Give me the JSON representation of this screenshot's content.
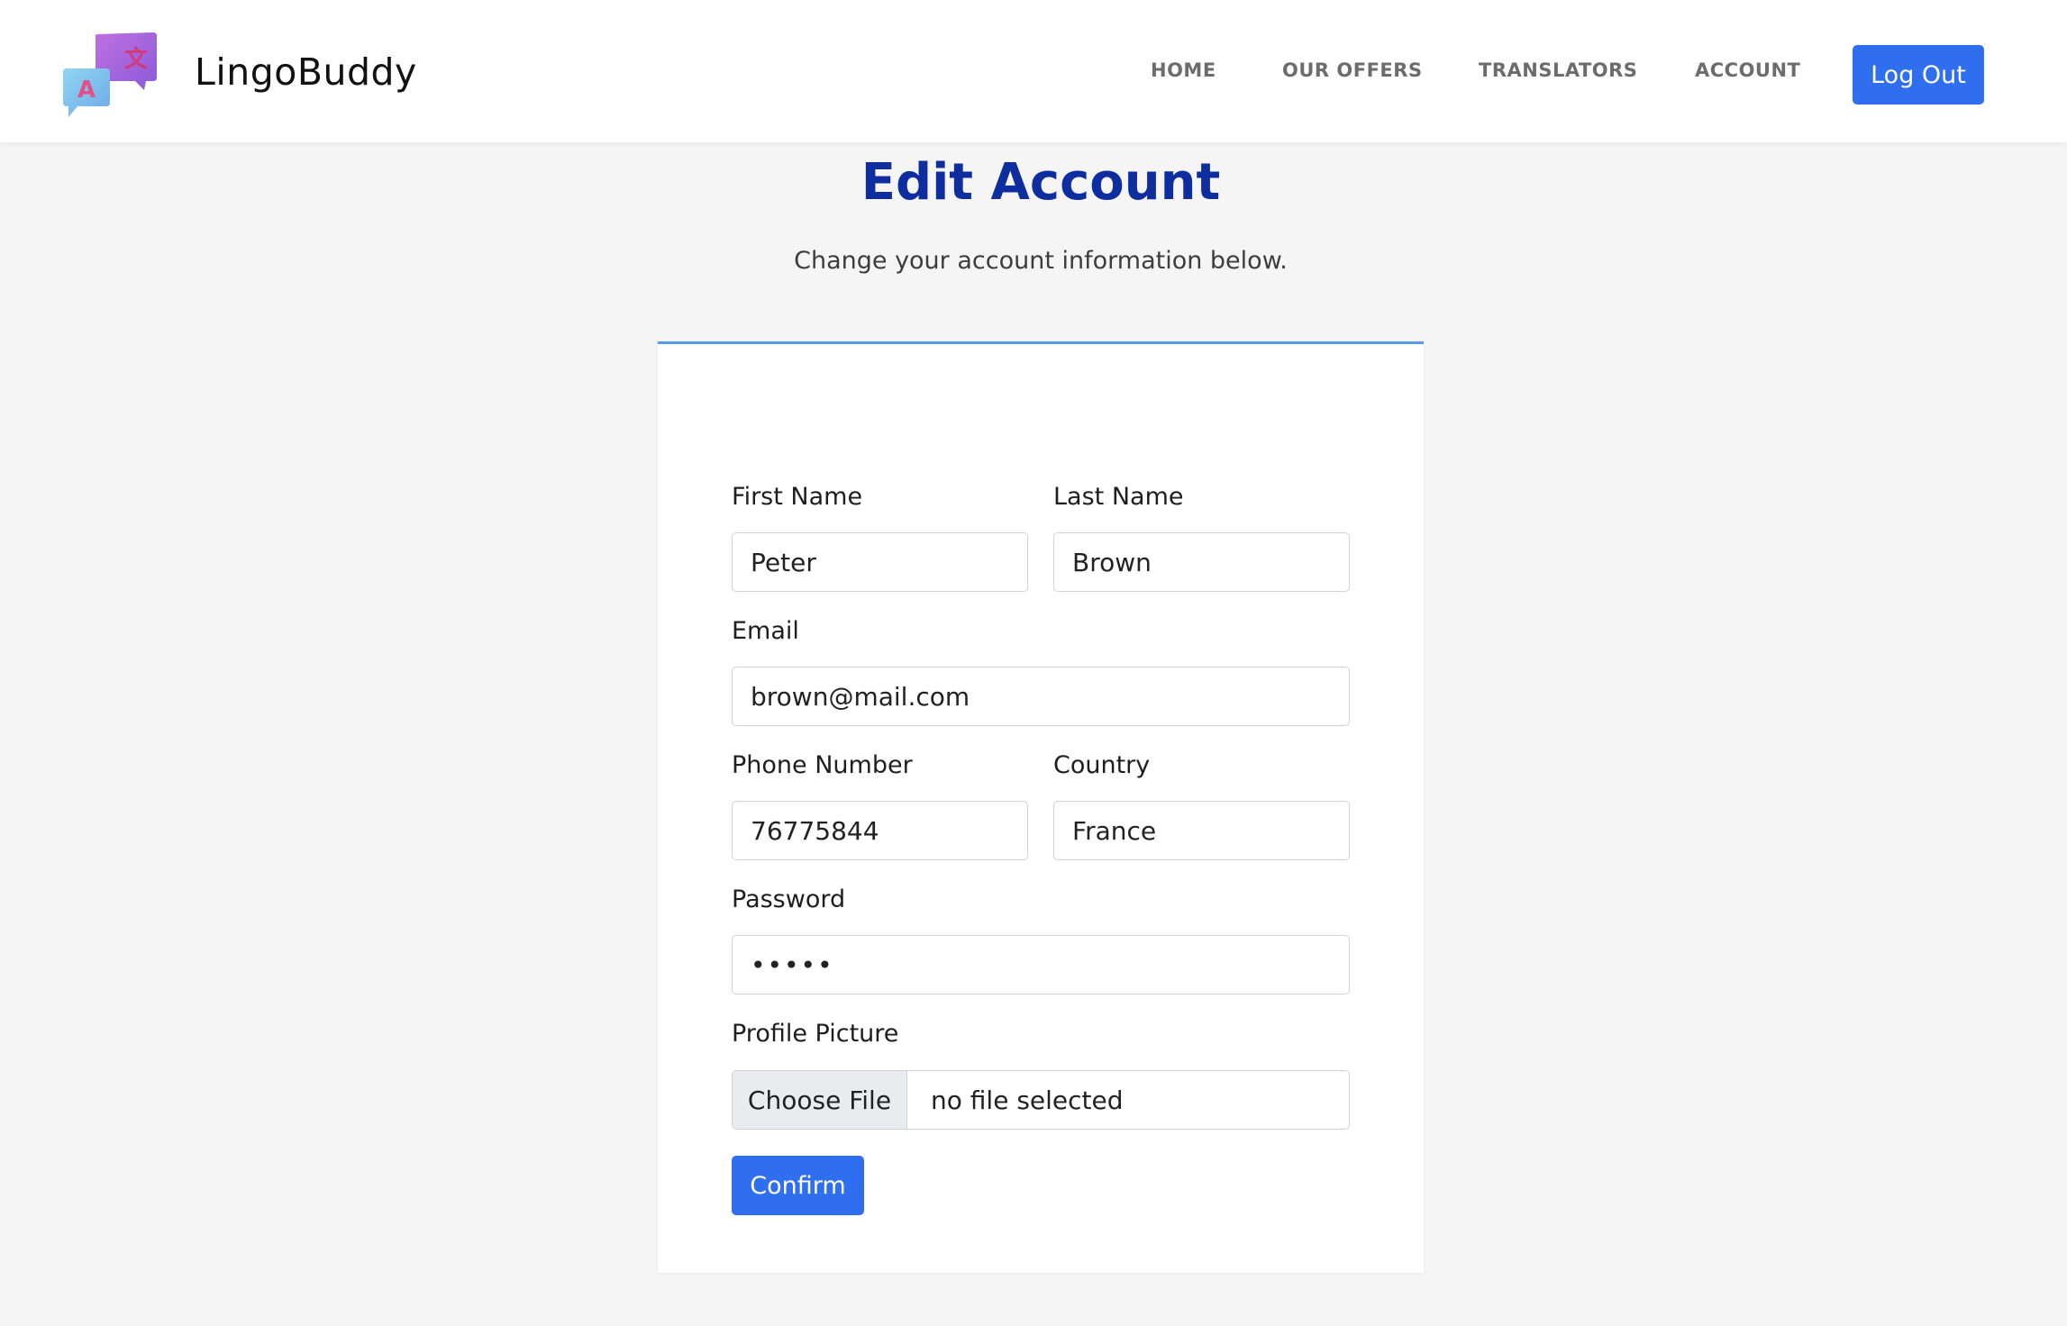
{
  "brand": {
    "name": "LingoBuddy",
    "logo_glyphs": [
      "A",
      "文"
    ]
  },
  "nav": {
    "links": [
      "HOME",
      "OUR OFFERS",
      "TRANSLATORS",
      "ACCOUNT"
    ],
    "logout_label": "Log Out"
  },
  "page": {
    "title": "Edit Account",
    "subtitle": "Change your account information below."
  },
  "form": {
    "first_name": {
      "label": "First Name",
      "value": "Peter"
    },
    "last_name": {
      "label": "Last Name",
      "value": "Brown"
    },
    "email": {
      "label": "Email",
      "value": "brown@mail.com"
    },
    "phone": {
      "label": "Phone Number",
      "value": "76775844"
    },
    "country": {
      "label": "Country",
      "value": "France"
    },
    "password": {
      "label": "Password",
      "value": "•••••"
    },
    "profile_picture": {
      "label": "Profile Picture",
      "button_label": "Choose File",
      "status": "no file selected"
    },
    "confirm_label": "Confirm"
  },
  "colors": {
    "accent": "#2f6fef",
    "title": "#0e2ea0",
    "card_border": "#5b9be6",
    "background": "#f5f5f5"
  }
}
